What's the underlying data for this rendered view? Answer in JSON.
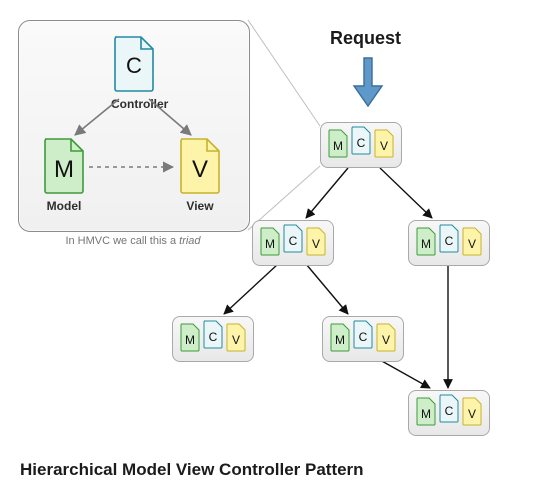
{
  "title": "Hierarchical Model View Controller Pattern",
  "request_label": "Request",
  "triad_caption_prefix": "In HMVC we call this a ",
  "triad_caption_em": "triad",
  "mvc": {
    "controller": {
      "letter": "C",
      "label": "Controller"
    },
    "model": {
      "letter": "M",
      "label": "Model"
    },
    "view": {
      "letter": "V",
      "label": "View"
    }
  },
  "chart_data": {
    "type": "diagram",
    "title": "Hierarchical Model View Controller Pattern",
    "inset": {
      "nodes": [
        {
          "id": "controller",
          "label": "Controller",
          "letter": "C"
        },
        {
          "id": "model",
          "label": "Model",
          "letter": "M"
        },
        {
          "id": "view",
          "label": "View",
          "letter": "V"
        }
      ],
      "edges": [
        {
          "from": "controller",
          "to": "model",
          "style": "solid"
        },
        {
          "from": "controller",
          "to": "view",
          "style": "solid"
        },
        {
          "from": "model",
          "to": "view",
          "style": "dashed"
        }
      ],
      "caption": "In HMVC we call this a triad"
    },
    "hierarchy": {
      "root_input": "Request",
      "nodes": [
        "t1",
        "t2",
        "t3",
        "t4",
        "t5",
        "t6"
      ],
      "edges": [
        {
          "from": "t1",
          "to": "t2"
        },
        {
          "from": "t1",
          "to": "t3"
        },
        {
          "from": "t2",
          "to": "t4"
        },
        {
          "from": "t2",
          "to": "t5"
        },
        {
          "from": "t3",
          "to": "t6"
        },
        {
          "from": "t5",
          "to": "t6"
        }
      ]
    },
    "inset_projection": {
      "from": "inset",
      "to": "t1",
      "style": "faint"
    }
  },
  "colors": {
    "controller_fill": "#eaf6f8",
    "controller_stroke": "#228aa0",
    "model_fill": "#cdeec8",
    "model_stroke": "#3f9a3b",
    "view_fill": "#fdf3a9",
    "view_stroke": "#c7b32a",
    "arrow_request": "#4f8ec2",
    "arrow_tree": "#111111",
    "arrow_inset": "#7a7a7a",
    "projection": "#bfbfbf"
  }
}
